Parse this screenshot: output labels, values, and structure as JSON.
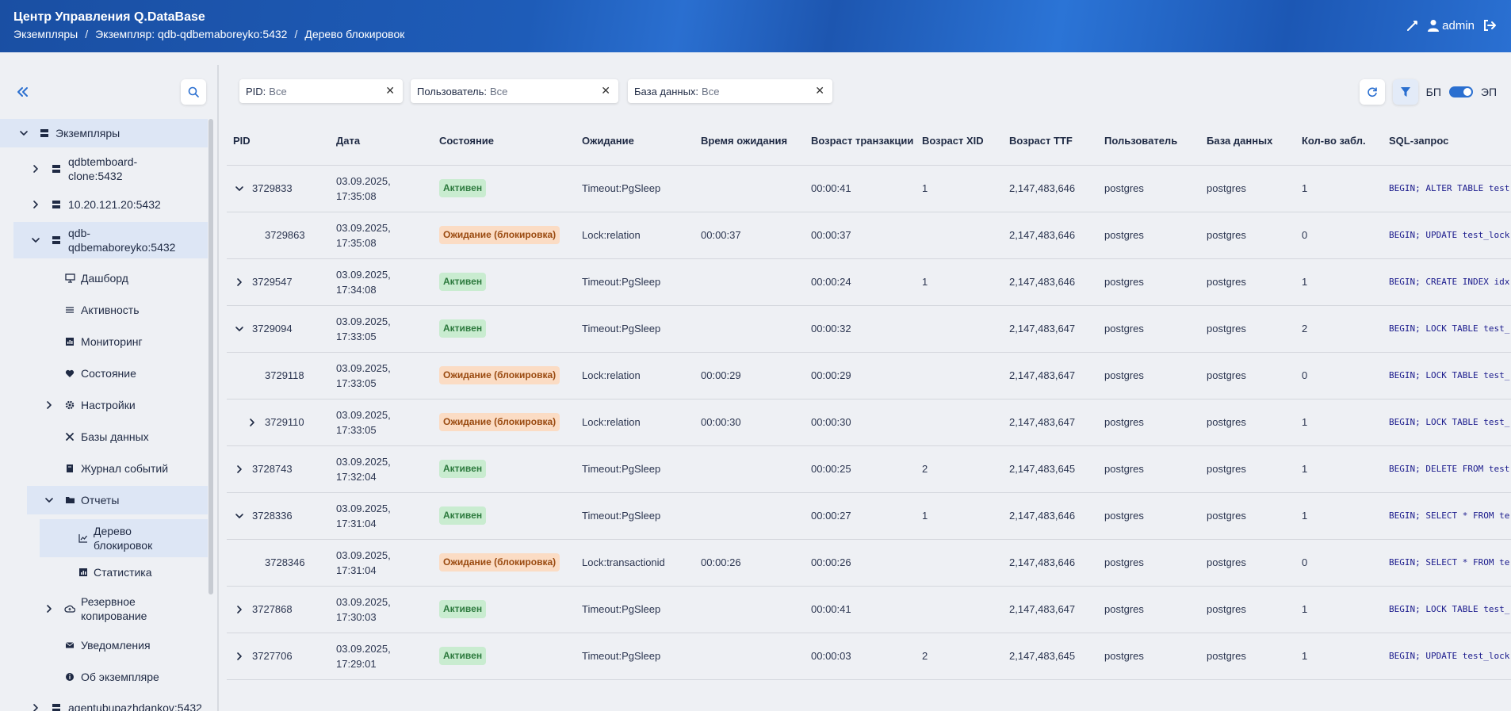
{
  "header": {
    "title": "Центр Управления Q.DataBase",
    "breadcrumb": [
      "Экземпляры",
      "Экземпляр: qdb-qdbemaboreyko:5432",
      "Дерево блокировок"
    ],
    "user": "admin"
  },
  "sidebar": {
    "items": [
      {
        "label": "Экземпляры"
      },
      {
        "label": "qdbtemboard-\nclone:5432"
      },
      {
        "label": "10.20.121.20:5432"
      },
      {
        "label": "qdb-\nqdbemaboreyko:5432"
      },
      {
        "label": "Дашборд"
      },
      {
        "label": "Активность"
      },
      {
        "label": "Мониторинг"
      },
      {
        "label": "Состояние"
      },
      {
        "label": "Настройки"
      },
      {
        "label": "Базы данных"
      },
      {
        "label": "Журнал событий"
      },
      {
        "label": "Отчеты"
      },
      {
        "label": "Дерево\nблокировок"
      },
      {
        "label": "Статистика"
      },
      {
        "label": "Резервное\nкопирование"
      },
      {
        "label": "Уведомления"
      },
      {
        "label": "Об экземпляре"
      },
      {
        "label": "agentubupazhdankov:5432"
      }
    ]
  },
  "filters": [
    {
      "label": "PID:",
      "value": "Все"
    },
    {
      "label": "Пользователь:",
      "value": "Все"
    },
    {
      "label": "База данных:",
      "value": "Все"
    }
  ],
  "toolbar": {
    "toggle_left": "БП",
    "toggle_right": "ЭП"
  },
  "table": {
    "columns": [
      "PID",
      "Дата",
      "Состояние",
      "Ожидание",
      "Время ожидания",
      "Возраст транзакции",
      "Возраст XID",
      "Возраст TTF",
      "Пользователь",
      "База данных",
      "Кол-во забл.",
      "SQL-запрос"
    ],
    "rows": [
      {
        "pid": "3729833",
        "date1": "03.09.2025,",
        "date2": "17:35:08",
        "state": "Активен",
        "wait": "Timeout:PgSleep",
        "wait_time": "",
        "tx_age": "00:00:41",
        "xid": "1",
        "ttf": "2,147,483,646",
        "user": "postgres",
        "db": "postgres",
        "locks": "1",
        "sql": "BEGIN; ALTER TABLE test"
      },
      {
        "pid": "3729863",
        "date1": "03.09.2025,",
        "date2": "17:35:08",
        "state": "Ожидание (блокировка)",
        "wait": "Lock:relation",
        "wait_time": "00:00:37",
        "tx_age": "00:00:37",
        "xid": "",
        "ttf": "2,147,483,646",
        "user": "postgres",
        "db": "postgres",
        "locks": "0",
        "sql": "BEGIN; UPDATE test_lock"
      },
      {
        "pid": "3729547",
        "date1": "03.09.2025,",
        "date2": "17:34:08",
        "state": "Активен",
        "wait": "Timeout:PgSleep",
        "wait_time": "",
        "tx_age": "00:00:24",
        "xid": "1",
        "ttf": "2,147,483,646",
        "user": "postgres",
        "db": "postgres",
        "locks": "1",
        "sql": "BEGIN; CREATE INDEX idx"
      },
      {
        "pid": "3729094",
        "date1": "03.09.2025,",
        "date2": "17:33:05",
        "state": "Активен",
        "wait": "Timeout:PgSleep",
        "wait_time": "",
        "tx_age": "00:00:32",
        "xid": "",
        "ttf": "2,147,483,647",
        "user": "postgres",
        "db": "postgres",
        "locks": "2",
        "sql": "BEGIN; LOCK TABLE test_"
      },
      {
        "pid": "3729118",
        "date1": "03.09.2025,",
        "date2": "17:33:05",
        "state": "Ожидание (блокировка)",
        "wait": "Lock:relation",
        "wait_time": "00:00:29",
        "tx_age": "00:00:29",
        "xid": "",
        "ttf": "2,147,483,647",
        "user": "postgres",
        "db": "postgres",
        "locks": "0",
        "sql": "BEGIN; LOCK TABLE test_"
      },
      {
        "pid": "3729110",
        "date1": "03.09.2025,",
        "date2": "17:33:05",
        "state": "Ожидание (блокировка)",
        "wait": "Lock:relation",
        "wait_time": "00:00:30",
        "tx_age": "00:00:30",
        "xid": "",
        "ttf": "2,147,483,647",
        "user": "postgres",
        "db": "postgres",
        "locks": "1",
        "sql": "BEGIN; LOCK TABLE test_"
      },
      {
        "pid": "3728743",
        "date1": "03.09.2025,",
        "date2": "17:32:04",
        "state": "Активен",
        "wait": "Timeout:PgSleep",
        "wait_time": "",
        "tx_age": "00:00:25",
        "xid": "2",
        "ttf": "2,147,483,645",
        "user": "postgres",
        "db": "postgres",
        "locks": "1",
        "sql": "BEGIN; DELETE FROM test"
      },
      {
        "pid": "3728336",
        "date1": "03.09.2025,",
        "date2": "17:31:04",
        "state": "Активен",
        "wait": "Timeout:PgSleep",
        "wait_time": "",
        "tx_age": "00:00:27",
        "xid": "1",
        "ttf": "2,147,483,646",
        "user": "postgres",
        "db": "postgres",
        "locks": "1",
        "sql": "BEGIN; SELECT * FROM te"
      },
      {
        "pid": "3728346",
        "date1": "03.09.2025,",
        "date2": "17:31:04",
        "state": "Ожидание (блокировка)",
        "wait": "Lock:transactionid",
        "wait_time": "00:00:26",
        "tx_age": "00:00:26",
        "xid": "",
        "ttf": "2,147,483,646",
        "user": "postgres",
        "db": "postgres",
        "locks": "0",
        "sql": "BEGIN; SELECT * FROM te"
      },
      {
        "pid": "3727868",
        "date1": "03.09.2025,",
        "date2": "17:30:03",
        "state": "Активен",
        "wait": "Timeout:PgSleep",
        "wait_time": "",
        "tx_age": "00:00:41",
        "xid": "",
        "ttf": "2,147,483,647",
        "user": "postgres",
        "db": "postgres",
        "locks": "1",
        "sql": "BEGIN; LOCK TABLE test_"
      },
      {
        "pid": "3727706",
        "date1": "03.09.2025,",
        "date2": "17:29:01",
        "state": "Активен",
        "wait": "Timeout:PgSleep",
        "wait_time": "",
        "tx_age": "00:00:03",
        "xid": "2",
        "ttf": "2,147,483,645",
        "user": "postgres",
        "db": "postgres",
        "locks": "1",
        "sql": "BEGIN; UPDATE test_lock"
      }
    ]
  },
  "colors": {
    "accent": "#2a6fd0",
    "active_bg": "#c9ecd0",
    "wait_bg": "#fbdcc4"
  }
}
